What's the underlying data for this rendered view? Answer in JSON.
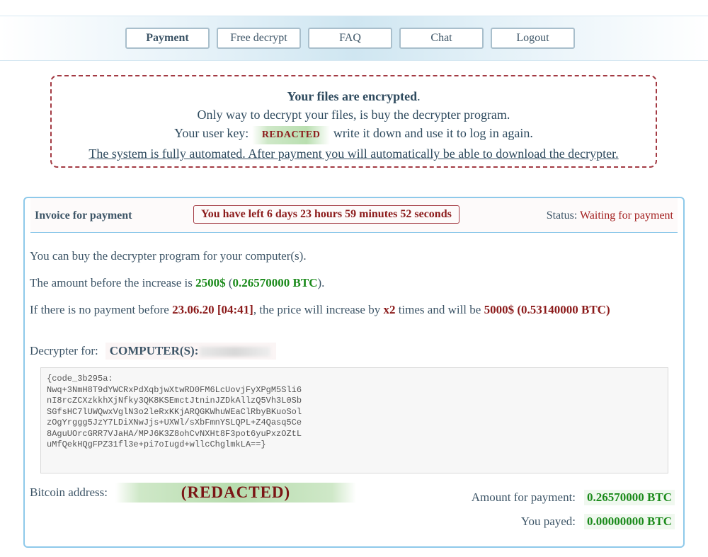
{
  "nav": {
    "items": [
      "Payment",
      "Free decrypt",
      "FAQ",
      "Chat",
      "Logout"
    ],
    "active": "Payment"
  },
  "notice": {
    "heading_bold": "Your files are encrypted",
    "heading_end": ".",
    "line2": "Only way to decrypt your files, is buy the decrypter program.",
    "line3_prefix": "Your user key:",
    "user_key": "REDACTED",
    "line3_suffix": "write it down and use it to log in again.",
    "line4": "The system is fully automated. After payment you will automatically be able to download the decrypter."
  },
  "invoice": {
    "title": "Invoice for payment",
    "timer": "You have left 6 days 23 hours 59 minutes 52 seconds",
    "status_label": "Status:",
    "status_value": "Waiting for payment",
    "line1": "You can buy the decrypter program for your computer(s).",
    "line2_prefix": "The amount before the increase is",
    "amount_usd": "2500$",
    "amount_btc": "0.26570000 BTC",
    "line3_prefix": "If there is no payment before",
    "deadline": "23.06.20 [04:41]",
    "line3_mid": ", the price will increase by",
    "multiplier": "x2",
    "line3_mid2": "times and will be",
    "increased_usd": "5000$",
    "increased_btc": "0.53140000 BTC",
    "decrypter_for_label": "Decrypter for:",
    "computers_label": "COMPUTER(S):",
    "code": "{code_3b295a:\nNwq+3NmH8T9dYWCRxPdXqbjwXtwRD0FM6LcUovjFyXPgM5Sli6\nnI8rcZCXzkkhXjNfky3QK8KSEmctJtninJZDkAllzQ5Vh3L0Sb\nSGfsHC7lUWQwxVglN3o2leRxKKjARQGKWhuWEaClRbyBKuoSol\nzOgYrggg5JzY7LDiXNwJjs+UXWl/sXbFmnYSLQPL+Z4Qasq5Ce\n8AguUOrcGRR7VJaHA/MPJ6K3Z8ohCvNXHt8F3pot6yuPxzOZtL\nuMfQekHQgFPZ31fl3e+pi7oIugd+wllcChglmkLA==}",
    "bitcoin_label": "Bitcoin address:",
    "bitcoin_address": "(REDACTED)",
    "amount_label": "Amount for payment:",
    "amount_value": "0.26570000 BTC",
    "payed_label": "You payed:",
    "payed_value": "0.00000000 BTC"
  },
  "colors": {
    "accent_border": "#8ec9ea",
    "alert_red": "#8b1a1a",
    "money_green": "#1a8a1a",
    "text": "#3d5567"
  }
}
